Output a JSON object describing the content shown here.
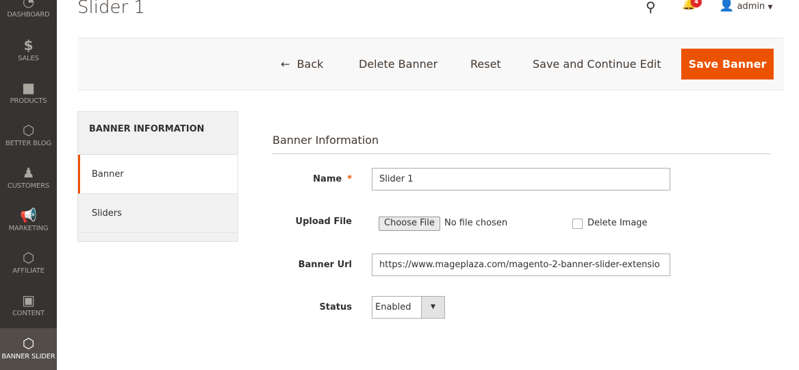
{
  "sidebar": {
    "items": [
      {
        "label": "DASHBOARD",
        "icon": "dashboard-icon"
      },
      {
        "label": "SALES",
        "icon": "dollar-icon"
      },
      {
        "label": "PRODUCTS",
        "icon": "box-icon"
      },
      {
        "label": "BETTER BLOG",
        "icon": "hexagon-icon"
      },
      {
        "label": "CUSTOMERS",
        "icon": "person-icon"
      },
      {
        "label": "MARKETING",
        "icon": "megaphone-icon"
      },
      {
        "label": "AFFILIATE",
        "icon": "hexagon-icon"
      },
      {
        "label": "CONTENT",
        "icon": "layout-icon"
      },
      {
        "label": "BANNER SLIDER",
        "icon": "hexagon-icon",
        "active": true
      }
    ]
  },
  "header": {
    "title": "Slider 1",
    "notifications": "4",
    "user": "admin"
  },
  "toolbar": {
    "back": "Back",
    "delete": "Delete Banner",
    "reset": "Reset",
    "save_continue": "Save and Continue Edit",
    "save": "Save Banner",
    "accent": "#eb5202"
  },
  "tabs": {
    "title": "BANNER INFORMATION",
    "items": [
      "Banner",
      "Sliders"
    ]
  },
  "form": {
    "section_title": "Banner Information",
    "name_label": "Name",
    "name_value": "Slider 1",
    "upload_label": "Upload File",
    "choose_file": "Choose File",
    "no_file": "No file chosen",
    "delete_image": "Delete Image",
    "url_label": "Banner Url",
    "url_value": "https://www.mageplaza.com/magento-2-banner-slider-extensio",
    "status_label": "Status",
    "status_value": "Enabled"
  }
}
